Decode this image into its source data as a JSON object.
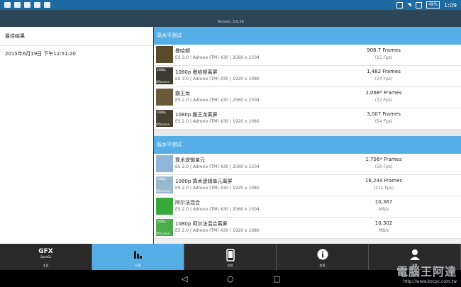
{
  "status": {
    "time": "1:09",
    "battery": "49%"
  },
  "header": {
    "version": "Version: 3.0.36"
  },
  "left": {
    "heading": "最佳结果",
    "date": "2015年6月19日 下午12:51:20"
  },
  "high_section": {
    "title": "高水平测试",
    "rows": [
      {
        "name": "曼哈顿",
        "info": "ES 3.0 | Adreno (TM) 430 | 2560 x 1504",
        "value": "908.7 Frames",
        "sub": "(15 Fps)",
        "offscreen": false
      },
      {
        "name": "1080p 曼哈顿离屏",
        "info": "ES 3.0 | Adreno (TM) 430 | 1920 x 1080",
        "value": "1,482 Frames",
        "sub": "(24 Fps)",
        "offscreen": true
      },
      {
        "name": "霸王龙",
        "info": "ES 2.0 | Adreno (TM) 430 | 2560 x 1504",
        "value": "2,068* Frames",
        "sub": "(37 Fps)",
        "offscreen": false
      },
      {
        "name": "1080p 霸王龙离屏",
        "info": "ES 2.0 | Adreno (TM) 430 | 1920 x 1080",
        "value": "3,007 Frames",
        "sub": "(54 Fps)",
        "offscreen": true
      }
    ]
  },
  "low_section": {
    "title": "低水平测试",
    "rows": [
      {
        "name": "算术逻辑单元",
        "info": "ES 2.0 | Adreno (TM) 430 | 2560 x 1504",
        "value": "1,756* Frames",
        "sub": "(59 Fps)",
        "offscreen": false
      },
      {
        "name": "1080p 算术逻辑单元离屏",
        "info": "ES 2.0 | Adreno (TM) 430 | 1920 x 1080",
        "value": "16,244 Frames",
        "sub": "(271 Fps)",
        "offscreen": true
      },
      {
        "name": "阿尔法混合",
        "info": "ES 2.0 | Adreno (TM) 430 | 2560 x 1504",
        "value": "10,367",
        "sub": "MB/s",
        "offscreen": false
      },
      {
        "name": "1080p 阿尔法混合离屏",
        "info": "ES 2.0 | Adreno (TM) 430 | 1920 x 1080",
        "value": "10,302",
        "sub": "MB/s",
        "offscreen": true
      }
    ]
  },
  "thumb_labels": {
    "res": "1080p",
    "off": "Offscreen"
  },
  "tabs": {
    "logo": "GFX",
    "logo_sub": "OpenGL",
    "items": [
      "主页",
      "结果",
      "比较",
      "信息",
      "设置"
    ]
  },
  "watermark": {
    "line1": "電腦王阿達",
    "line2": "http://www.kocpc.com.tw"
  },
  "colors": {
    "accent": "#55aee6",
    "statusbar": "#1c6aa1",
    "titlebar": "#2d4657"
  }
}
